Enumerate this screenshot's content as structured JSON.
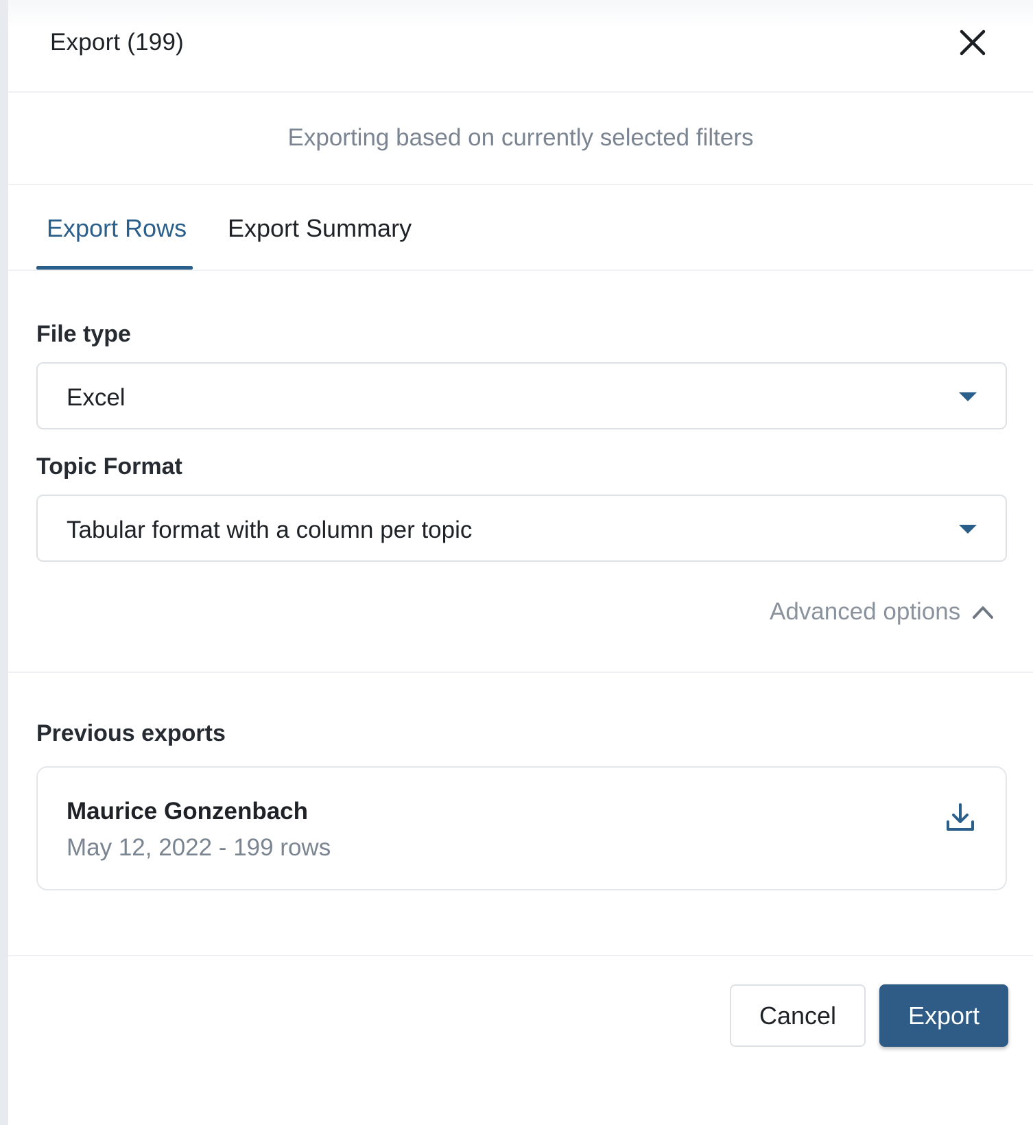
{
  "dialog": {
    "title": "Export (199)",
    "close_icon": "close-icon"
  },
  "filter_note": "Exporting based on currently selected filters",
  "tabs": [
    {
      "label": "Export Rows",
      "active": true
    },
    {
      "label": "Export Summary",
      "active": false
    }
  ],
  "form": {
    "file_type": {
      "label": "File type",
      "value": "Excel",
      "icon": "caret-down-icon"
    },
    "topic_format": {
      "label": "Topic Format",
      "value": "Tabular format with a column per topic",
      "icon": "caret-down-icon"
    },
    "advanced_options": {
      "label": "Advanced options",
      "icon": "chevron-up-icon",
      "expanded": true
    }
  },
  "previous_exports": {
    "title": "Previous exports",
    "items": [
      {
        "name": "Maurice Gonzenbach",
        "meta": "May 12, 2022 - 199 rows",
        "icon": "download-icon"
      }
    ]
  },
  "footer": {
    "cancel_label": "Cancel",
    "export_label": "Export"
  },
  "colors": {
    "accent": "#2b5f8b",
    "primary_button": "#2e5c86",
    "muted_text": "#7b8591",
    "border": "#dde1e6"
  }
}
